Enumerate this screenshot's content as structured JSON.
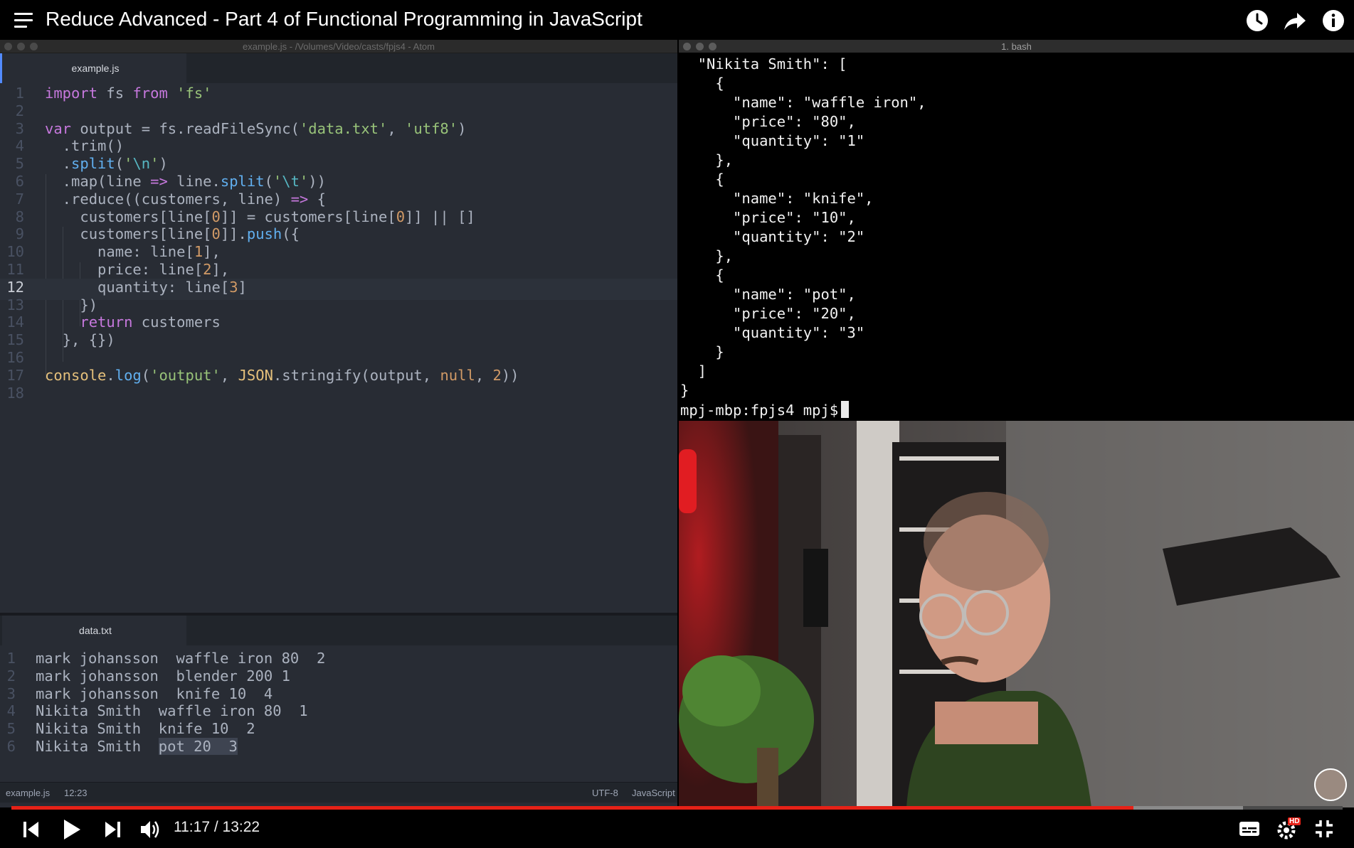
{
  "video": {
    "title": "Reduce Advanced - Part 4 of Functional Programming in JavaScript",
    "current_time": "11:17",
    "duration": "13:22",
    "progress_played": 0.843,
    "progress_loaded": 0.925,
    "hd_badge": "HD"
  },
  "editor": {
    "window_title": "example.js - /Volumes/Video/casts/fpjs4 - Atom",
    "top_tab": "example.js",
    "bottom_tab": "data.txt",
    "code_lines": [
      {
        "n": "1",
        "html": "<span class='kw'>import</span> fs <span class='kw'>from</span> <span class='str'>'fs'</span>"
      },
      {
        "n": "2",
        "html": ""
      },
      {
        "n": "3",
        "html": "<span class='kw'>var</span> output = fs.readFileSync(<span class='str'>'data.txt'</span>, <span class='str'>'utf8'</span>)"
      },
      {
        "n": "4",
        "html": "  .trim()"
      },
      {
        "n": "5",
        "html": "  .<span class='fn'>split</span>(<span class='str'>'<span class=\"cyan\">\\n</span>'</span>)"
      },
      {
        "n": "6",
        "html": "  .map(line <span class='kw'>=&gt;</span> line.<span class='fn'>split</span>(<span class='str'>'<span class=\"cyan\">\\t</span>'</span>))"
      },
      {
        "n": "7",
        "html": "  .reduce((customers, line) <span class='kw'>=&gt;</span> {"
      },
      {
        "n": "8",
        "html": "    customers[line[<span class='num-lit'>0</span>]] = customers[line[<span class='num-lit'>0</span>]] || []"
      },
      {
        "n": "9",
        "html": "    customers[line[<span class='num-lit'>0</span>]].<span class='fn'>push</span>({"
      },
      {
        "n": "10",
        "html": "      name: line[<span class='num-lit'>1</span>],"
      },
      {
        "n": "11",
        "html": "      price: line[<span class='num-lit'>2</span>],"
      },
      {
        "n": "12",
        "html": "      quantity: line[<span class='num-lit'>3</span>]"
      },
      {
        "n": "13",
        "html": "    })"
      },
      {
        "n": "14",
        "html": "    <span class='kw'>return</span> customers"
      },
      {
        "n": "15",
        "html": "  }, {})"
      },
      {
        "n": "16",
        "html": ""
      },
      {
        "n": "17",
        "html": "<span class='obj'>console</span>.<span class='fn'>log</span>(<span class='str'>'output'</span>, <span class='obj'>JSON</span>.stringify(output, <span class='num-lit'>null</span>, <span class='num-lit'>2</span>))"
      },
      {
        "n": "18",
        "html": ""
      }
    ],
    "active_line": "12",
    "data_lines": [
      {
        "n": "1",
        "text": "mark johansson  waffle iron 80  2"
      },
      {
        "n": "2",
        "text": "mark johansson  blender 200 1"
      },
      {
        "n": "3",
        "text": "mark johansson  knife 10  4"
      },
      {
        "n": "4",
        "text": "Nikita Smith  waffle iron 80  1"
      },
      {
        "n": "5",
        "text": "Nikita Smith  knife 10  2"
      },
      {
        "n": "6",
        "text": "Nikita Smith  ",
        "selected": "pot 20  3"
      }
    ],
    "status": {
      "file": "example.js",
      "cursor": "12:23",
      "encoding": "UTF-8",
      "grammar": "JavaScript"
    }
  },
  "terminal": {
    "title": "1. bash",
    "lines": [
      "  \"Nikita Smith\": [",
      "    {",
      "      \"name\": \"waffle iron\",",
      "      \"price\": \"80\",",
      "      \"quantity\": \"1\"",
      "    },",
      "    {",
      "      \"name\": \"knife\",",
      "      \"price\": \"10\",",
      "      \"quantity\": \"2\"",
      "    },",
      "    {",
      "      \"name\": \"pot\",",
      "      \"price\": \"20\",",
      "      \"quantity\": \"3\"",
      "    }",
      "  ]",
      "}"
    ],
    "prompt": "mpj-mbp:fpjs4 mpj$"
  },
  "icons": {
    "menu": "menu-icon",
    "watch_later": "clock-icon",
    "share": "share-icon",
    "info": "info-icon",
    "prev": "previous-icon",
    "play": "play-icon",
    "next": "next-icon",
    "volume": "volume-icon",
    "subtitles": "subtitles-icon",
    "settings": "gear-icon",
    "fullscreen": "exit-fullscreen-icon"
  },
  "colors": {
    "progress_played": "#e62117",
    "editor_bg": "#282c34",
    "keyword": "#c678dd",
    "string": "#98c379"
  }
}
